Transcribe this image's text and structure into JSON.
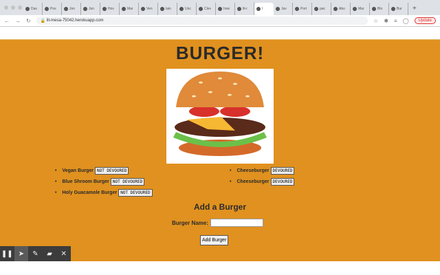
{
  "browser": {
    "tabs": [
      "Das",
      "Pos",
      "Jon",
      "Jon",
      "Hov",
      "Mar",
      "Ven",
      "lain",
      "Unc",
      "Clev",
      "how",
      "lit-r",
      "I",
      "Jav",
      "Port",
      "pac",
      "Abo",
      "Mar",
      "Blo",
      "Bur"
    ],
    "url": "lit-mesa-75042.herokuapp.com",
    "update_label": "Update"
  },
  "page": {
    "title": "BURGER!",
    "left_list": [
      {
        "name": "Vegan Burger",
        "button": "NOT DEVOURED"
      },
      {
        "name": "Blue Shroom Burger",
        "button": "NOT DEVOURED"
      },
      {
        "name": "Holy Guacamole Burger",
        "button": "NOT DEVOURED"
      }
    ],
    "right_list": [
      {
        "name": "Cheeseburger",
        "button": "DEVOURED"
      },
      {
        "name": "Cheeseburger",
        "button": "DEVOURED"
      }
    ],
    "form_title": "Add a Burger",
    "form_label": "Burger Name:",
    "input_value": "",
    "submit_label": "Add Burger"
  },
  "colors": {
    "background": "#e0911f"
  }
}
